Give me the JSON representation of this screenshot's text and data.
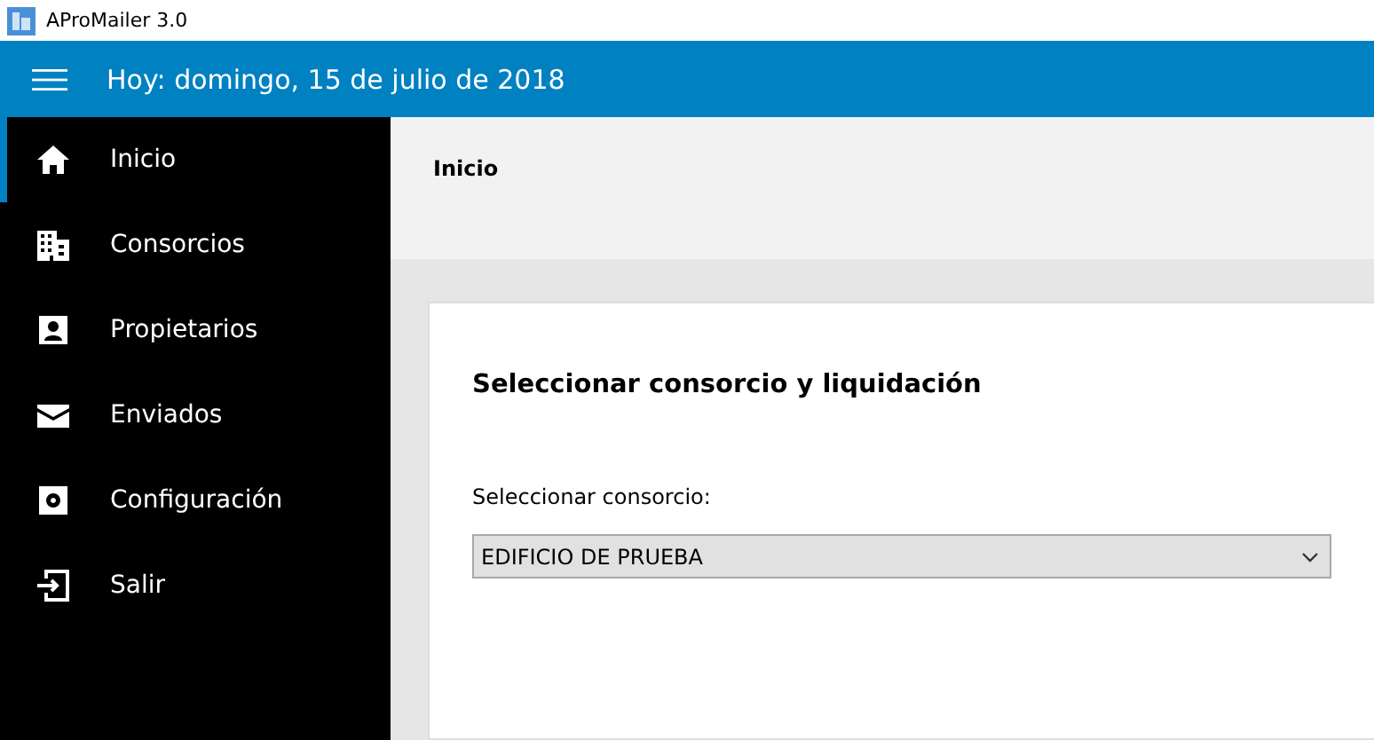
{
  "window": {
    "title": "AProMailer 3.0"
  },
  "app_bar": {
    "title": "Hoy:  domingo, 15 de julio de 2018"
  },
  "sidebar": {
    "items": [
      {
        "label": "Inicio",
        "selected": true
      },
      {
        "label": "Consorcios",
        "selected": false
      },
      {
        "label": "Propietarios",
        "selected": false
      },
      {
        "label": "Enviados",
        "selected": false
      },
      {
        "label": "Configuración",
        "selected": false
      },
      {
        "label": "Salir",
        "selected": false
      }
    ]
  },
  "page": {
    "header": "Inicio",
    "card": {
      "title": "Seleccionar consorcio y liquidación",
      "field_label": "Seleccionar consorcio:",
      "dropdown": {
        "value": "EDIFICIO DE PRUEBA"
      }
    }
  }
}
